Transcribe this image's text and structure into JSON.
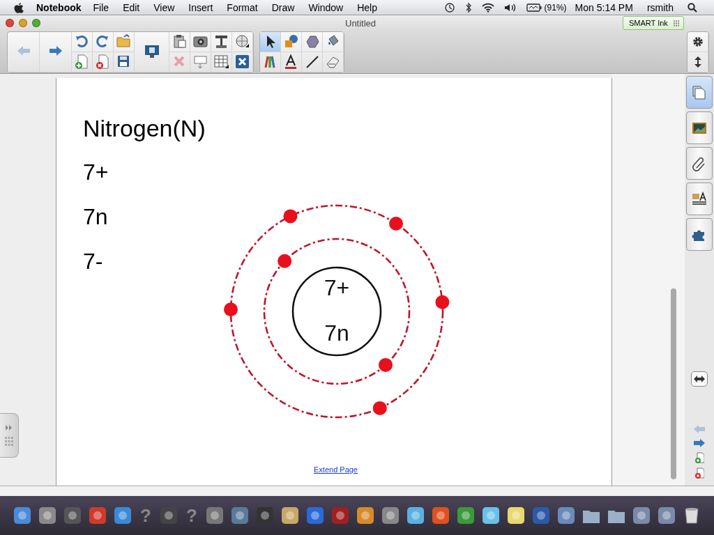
{
  "menu_bar": {
    "app_name": "Notebook",
    "menus": [
      "File",
      "Edit",
      "View",
      "Insert",
      "Format",
      "Draw",
      "Window",
      "Help"
    ],
    "battery": "(91%)",
    "clock": "Mon 5:14 PM",
    "user": "rsmith"
  },
  "window": {
    "title": "Untitled",
    "ink_badge": "SMART Ink"
  },
  "page": {
    "texts": [
      "Nitrogen(N)",
      "7+",
      "7n",
      "7-"
    ],
    "diagram": {
      "nucleus": [
        "7+",
        "7n"
      ]
    },
    "extend_link": "Extend Page"
  },
  "side_tabs": [
    {
      "kind": "pages",
      "selected": true
    },
    {
      "kind": "gallery",
      "selected": false
    },
    {
      "kind": "attachments",
      "selected": false
    },
    {
      "kind": "properties",
      "selected": false
    },
    {
      "kind": "addons",
      "selected": false
    }
  ],
  "dock": [
    {
      "kind": "app"
    },
    {
      "kind": "app"
    },
    {
      "kind": "app"
    },
    {
      "kind": "app"
    },
    {
      "kind": "app"
    },
    {
      "kind": "missing",
      "glyph": "?"
    },
    {
      "kind": "app"
    },
    {
      "kind": "missing",
      "glyph": "?"
    },
    {
      "kind": "app"
    },
    {
      "kind": "app"
    },
    {
      "kind": "app"
    },
    {
      "kind": "app"
    },
    {
      "kind": "app"
    },
    {
      "kind": "app"
    },
    {
      "kind": "app"
    },
    {
      "kind": "app"
    },
    {
      "kind": "app"
    },
    {
      "kind": "app"
    },
    {
      "kind": "app"
    },
    {
      "kind": "app"
    },
    {
      "kind": "app"
    },
    {
      "kind": "app"
    },
    {
      "kind": "app"
    },
    {
      "kind": "folder"
    },
    {
      "kind": "folder"
    },
    {
      "kind": "app"
    },
    {
      "kind": "app"
    },
    {
      "kind": "trash"
    }
  ]
}
